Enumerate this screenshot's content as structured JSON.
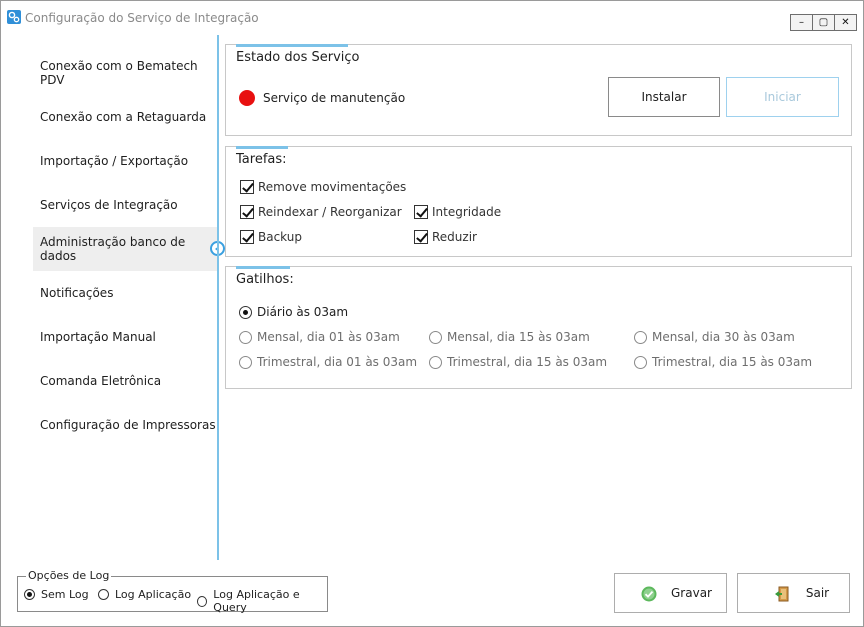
{
  "window": {
    "title": "Configuração do Serviço de Integração",
    "buttons": {
      "minimize": "–",
      "maximize": "▢",
      "close": "✕"
    }
  },
  "sidebar": {
    "items": [
      {
        "label": "Conexão com o Bematech PDV",
        "active": false
      },
      {
        "label": "Conexão com a Retaguarda",
        "active": false
      },
      {
        "label": "Importação / Exportação",
        "active": false
      },
      {
        "label": "Serviços de Integração",
        "active": false
      },
      {
        "label": "Administração banco de dados",
        "active": true
      },
      {
        "label": "Notificações",
        "active": false
      },
      {
        "label": "Importação Manual",
        "active": false
      },
      {
        "label": "Comanda Eletrônica",
        "active": false
      },
      {
        "label": "Configuração de Impressoras",
        "active": false
      }
    ]
  },
  "estado": {
    "title": "Estado dos Serviço",
    "status_text": "Serviço de manutenção",
    "status_color": "#e81010",
    "install_label": "Instalar",
    "start_label": "Iniciar"
  },
  "tarefas": {
    "title": "Tarefas:",
    "items": [
      {
        "label": "Remove movimentações",
        "checked": true
      },
      {
        "label": "Reindexar / Reorganizar",
        "checked": true
      },
      {
        "label": "Integridade",
        "checked": true
      },
      {
        "label": "Backup",
        "checked": true
      },
      {
        "label": "Reduzir",
        "checked": true
      }
    ]
  },
  "gatilhos": {
    "title": "Gatilhos:",
    "options": [
      {
        "label": "Diário às 03am",
        "selected": true
      },
      {
        "label": "Mensal, dia 01 às 03am",
        "selected": false
      },
      {
        "label": "Mensal, dia 15 às 03am",
        "selected": false
      },
      {
        "label": "Mensal, dia 30 às 03am",
        "selected": false
      },
      {
        "label": "Trimestral, dia 01 às 03am",
        "selected": false
      },
      {
        "label": "Trimestral, dia 15 às 03am",
        "selected": false
      },
      {
        "label": "Trimestral, dia 15 às 03am",
        "selected": false
      }
    ]
  },
  "log": {
    "title": "Opções de Log",
    "options": [
      {
        "label": "Sem Log",
        "selected": true
      },
      {
        "label": "Log Aplicação",
        "selected": false
      },
      {
        "label": "Log Aplicação e Query",
        "selected": false
      }
    ]
  },
  "footer": {
    "save_label": "Gravar",
    "exit_label": "Sair"
  },
  "colors": {
    "accent": "#7cc2e8",
    "active_arrow": "#3aa0e0",
    "save_icon": "#5cb85c"
  }
}
